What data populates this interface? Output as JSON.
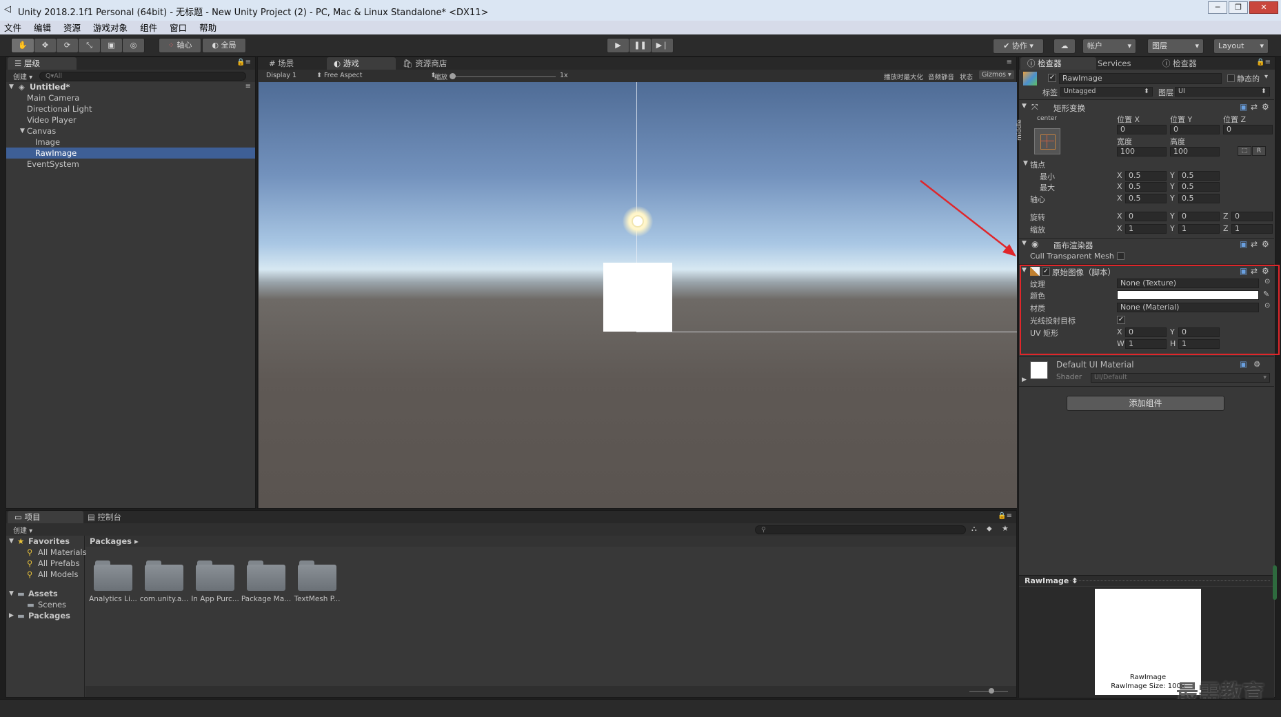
{
  "window": {
    "title": "Unity 2018.2.1f1 Personal (64bit) - 无标题 - New Unity Project (2) - PC, Mac & Linux Standalone* <DX11>",
    "minimize": "─",
    "restore": "❐",
    "close": "✕"
  },
  "menu": [
    "文件",
    "编辑",
    "资源",
    "游戏对象",
    "组件",
    "窗口",
    "帮助"
  ],
  "toolbar": {
    "pivot": "轴心",
    "global": "全局",
    "collab": "协作",
    "account": "帐户",
    "layers": "图层",
    "layout": "Layout"
  },
  "hierarchy": {
    "tab": "层级",
    "create": "创建",
    "search_placeholder": "Q▾All",
    "scene": "Untitled*",
    "items": [
      {
        "label": "Main Camera",
        "indent": 1
      },
      {
        "label": "Directional Light",
        "indent": 1
      },
      {
        "label": "Video Player",
        "indent": 1
      },
      {
        "label": "Canvas",
        "indent": 1
      },
      {
        "label": "Image",
        "indent": 2
      },
      {
        "label": "RawImage",
        "indent": 2,
        "selected": true
      },
      {
        "label": "EventSystem",
        "indent": 1
      }
    ]
  },
  "view_tabs": {
    "scene": "场景",
    "game": "游戏",
    "store": "资源商店",
    "display": "Display 1",
    "aspect": "Free Aspect",
    "scale_label": "缩放",
    "scale_value": "1x",
    "maximize": "播放时最大化",
    "mute": "音频静音",
    "stats": "状态",
    "gizmos": "Gizmos"
  },
  "project": {
    "tab_project": "项目",
    "tab_console": "控制台",
    "create": "创建",
    "favorites": "Favorites",
    "fav_items": [
      "All Materials",
      "All Prefabs",
      "All Models"
    ],
    "assets": "Assets",
    "scenes": "Scenes",
    "packages": "Packages",
    "breadcrumb": "Packages",
    "folders": [
      "Analytics Li...",
      "com.unity.a...",
      "In App Purc...",
      "Package Ma...",
      "TextMesh P..."
    ]
  },
  "inspector": {
    "tab1": "检查器",
    "tab2": "Services",
    "tab3": "检查器",
    "object_name": "RawImage",
    "static": "静态的",
    "tag_label": "标签",
    "tag_value": "Untagged",
    "layer_label": "图层",
    "layer_value": "UI",
    "rect": {
      "title": "矩形变换",
      "center": "center",
      "middle": "middle",
      "pos_x_label": "位置 X",
      "pos_y_label": "位置 Y",
      "pos_z_label": "位置 Z",
      "pos_x": "0",
      "pos_y": "0",
      "pos_z": "0",
      "width_label": "宽度",
      "height_label": "高度",
      "width": "100",
      "height": "100",
      "r_button": "R",
      "anchors": "锚点",
      "min": "最小",
      "max": "最大",
      "pivot": "轴心",
      "rotation": "旋转",
      "scale": "缩放",
      "min_x": "0.5",
      "min_y": "0.5",
      "max_x": "0.5",
      "max_y": "0.5",
      "pivot_x": "0.5",
      "pivot_y": "0.5",
      "rot_x": "0",
      "rot_y": "0",
      "rot_z": "0",
      "scale_x": "1",
      "scale_y": "1",
      "scale_z": "1",
      "x": "X",
      "y": "Y",
      "z": "Z"
    },
    "canvas_renderer": {
      "title": "画布渲染器",
      "cull": "Cull Transparent Mesh"
    },
    "raw_image": {
      "title": "原始图像（脚本）",
      "texture_label": "纹理",
      "texture_value": "None (Texture)",
      "color_label": "颜色",
      "material_label": "材质",
      "material_value": "None (Material)",
      "raycast_label": "光线投射目标",
      "uv_label": "UV 矩形",
      "uv_x": "0",
      "uv_y": "0",
      "uv_w": "1",
      "uv_h": "1",
      "w": "W",
      "h": "H"
    },
    "material": {
      "title": "Default UI Material",
      "shader_label": "Shader",
      "shader_value": "UI/Default"
    },
    "add_component": "添加组件",
    "preview_title": "RawImage",
    "preview_caption1": "RawImage",
    "preview_caption2": "RawImage Size: 100x"
  },
  "watermark": "最需教育",
  "colors": {
    "highlight": "#e0262a",
    "selection": "#3e5f96"
  }
}
